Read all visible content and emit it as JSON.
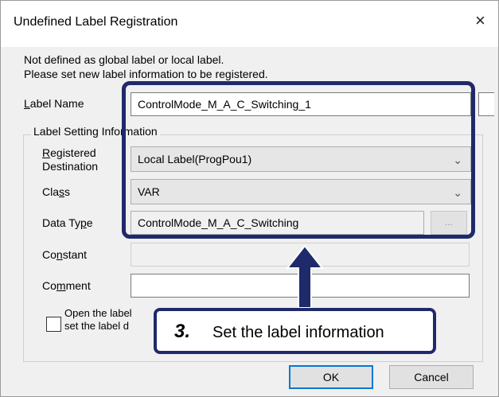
{
  "window": {
    "title": "Undefined Label Registration",
    "close_glyph": "×"
  },
  "message": {
    "line1": "Not defined as global label or local label.",
    "line2": "Please set new label information to be registered."
  },
  "label_name": {
    "label_pre": "",
    "label_u": "L",
    "label_post": "abel Name",
    "value": "ControlMode_M_A_C_Switching_1"
  },
  "group": {
    "title": "Label Setting Information"
  },
  "registered_destination": {
    "label_u": "R",
    "label_line1_post": "egistered",
    "label_line2": "Destination",
    "value": "Local Label(ProgPou1)"
  },
  "class": {
    "label_pre": "Cla",
    "label_u": "s",
    "label_post": "s",
    "value": "VAR"
  },
  "data_type": {
    "label_pre": "Data Ty",
    "label_u": "p",
    "label_post": "e",
    "value": "ControlMode_M_A_C_Switching",
    "browse_label": "..."
  },
  "constant": {
    "label_pre": "Co",
    "label_u": "n",
    "label_post": "stant",
    "value": ""
  },
  "comment": {
    "label_pre": "Co",
    "label_u": "m",
    "label_post": "ment",
    "value": ""
  },
  "checkbox": {
    "line1": "Open the label",
    "line2": "set the label d",
    "checked": false
  },
  "buttons": {
    "ok": "OK",
    "cancel": "Cancel"
  },
  "callout": {
    "number": "3.",
    "text": "Set the label information",
    "color": "#1f2a6b"
  }
}
